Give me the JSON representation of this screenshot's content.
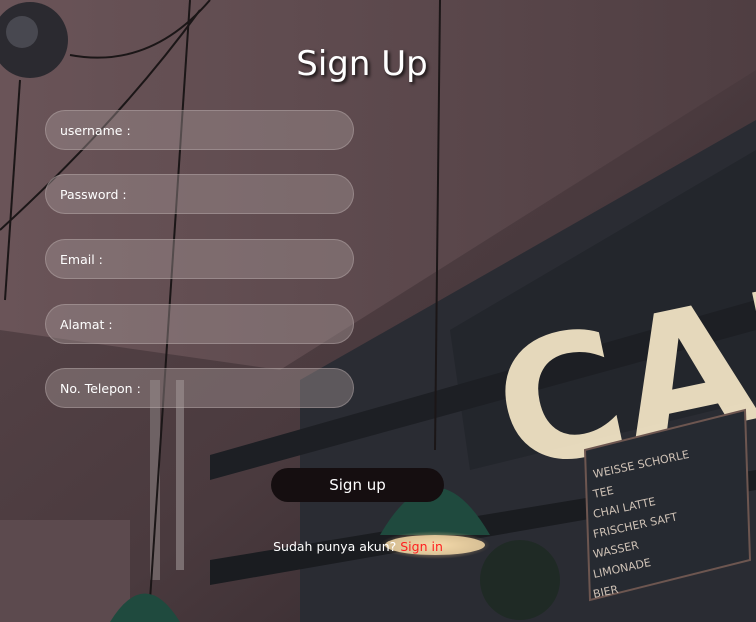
{
  "form": {
    "title": "Sign Up",
    "fields": [
      {
        "label": "username :",
        "value": ""
      },
      {
        "label": "Password :",
        "value": ""
      },
      {
        "label": "Email :",
        "value": ""
      },
      {
        "label": "Alamat :",
        "value": ""
      },
      {
        "label": "No. Telepon :",
        "value": ""
      }
    ],
    "submit_label": "Sign up",
    "signin_prompt": "Sudah punya akun?",
    "signin_link": "Sign in"
  },
  "background": {
    "sign_letters": "CAF",
    "menu_board_lines": [
      "WEISSE SCHORLE",
      "TEE",
      "CHAI LATTE",
      "FRISCHER SAFT",
      "WASSER",
      "LIMONADE",
      "BIER"
    ]
  },
  "colors": {
    "link": "#ff1f1f",
    "button_bg": "#150e10",
    "field_bg": "rgba(165,150,150,0.42)"
  }
}
